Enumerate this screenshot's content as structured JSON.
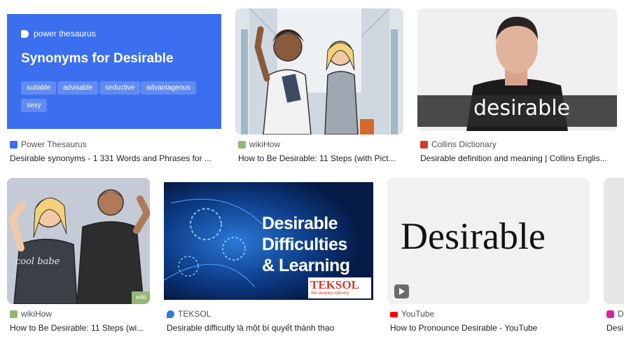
{
  "results": [
    {
      "source": "Power Thesaurus",
      "title": "Desirable synonyms - 1 331 Words and Phrases for ...",
      "thumb": {
        "brand": "power thesaurus",
        "heading": "Synonyms for Desirable",
        "chips": [
          "suitable",
          "advisable",
          "seductive",
          "advantageous",
          "sexy"
        ],
        "bg": "#3b6ff0"
      }
    },
    {
      "source": "wikiHow",
      "title": "How to Be Desirable: 11 Steps (with Pict..."
    },
    {
      "source": "Collins Dictionary",
      "title": "Desirable definition and meaning | Collins Englis...",
      "thumb": {
        "caption": "desirable"
      }
    },
    {
      "source": "wikiHow",
      "title": "How to Be Desirable: 11 Steps (wi...",
      "thumb": {
        "shirt_text": "cool babe",
        "corner": "wiki"
      }
    },
    {
      "source": "TEKSOL",
      "title": "Desirable difficulty là một bí quyết thành thạo",
      "thumb": {
        "lines": [
          "Desirable",
          "Difficulties",
          "& Learning"
        ],
        "logo": "TEKSOL",
        "tagline": "We develop industry"
      }
    },
    {
      "source": "YouTube",
      "title": "How to Pronounce Desirable - YouTube",
      "thumb": {
        "word": "Desirable"
      }
    },
    {
      "source": "D",
      "title": "Desi"
    }
  ],
  "colors": {
    "power_thesaurus_blue": "#3b6ff0",
    "wikihow_green": "#93b874",
    "collins_red": "#d8392b",
    "teksol_blue": "#0a2a66",
    "youtube_red": "#ff0000"
  }
}
